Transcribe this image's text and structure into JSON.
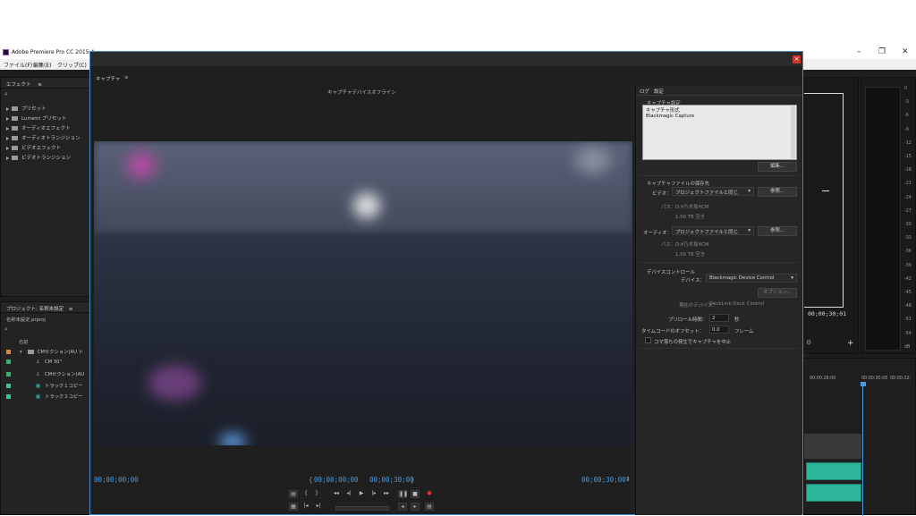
{
  "app": {
    "title": "Adobe Premiere Pro CC 2015.4 -",
    "window_controls": {
      "minimize": "–",
      "maximize": "❐",
      "close": "✕"
    }
  },
  "menu": [
    "ファイル(F)",
    "編集(E)",
    "クリップ(C)"
  ],
  "effects_panel": {
    "title": "エフェクト",
    "menu_glyph": "≡",
    "items": [
      "プリセット",
      "Lumetri プリセット",
      "オーディオエフェクト",
      "オーディオトランジション",
      "ビデオエフェクト",
      "ビデオトランジション"
    ]
  },
  "project_panel": {
    "title": "プロジェクト: 名称未設定",
    "menu_glyph": "≡",
    "more_glyph": "»",
    "file": "名称未設定.prproj",
    "column_name": "名前",
    "items": [
      {
        "label": "CMセクション(AU ト",
        "color": "#e08a2b",
        "kind": "folder"
      },
      {
        "label": "CM 30\"",
        "color": "#2fb56b",
        "kind": "sequence"
      },
      {
        "label": "CMセクション(AU",
        "color": "#2fb56b",
        "kind": "sequence"
      },
      {
        "label": "トラック１コピー",
        "color": "#2fc89a",
        "kind": "audio"
      },
      {
        "label": "トラック２コピー",
        "color": "#2fc89a",
        "kind": "audio"
      }
    ]
  },
  "capture": {
    "panel_title": "キャプチャ",
    "menu_glyph": "≡",
    "close": "×",
    "status": "キャプチャデバイスオフライン",
    "timecode_left": "00;00;00;00",
    "timecode_in": "00;00;00;00",
    "timecode_out": "00;00;30;00",
    "timecode_right": "00;00;30;00",
    "brace_open": "{",
    "brace_close": "}",
    "tabs": [
      "ログ",
      "設定"
    ],
    "settings": {
      "capture_settings_header": "キャプチャ設定",
      "capture_format_label": "キャプチャ形式",
      "capture_format_value": "Blackmagic Capture",
      "edit_button": "編集...",
      "locations_header": "キャプチャファイルの保存先",
      "video_label": "ビデオ：",
      "video_select": "プロジェクトファイルと同じ",
      "browse_button": "参照...",
      "path_label": "パス：",
      "video_path": "D:¥乃木坂¥CM",
      "video_free": "1.56 TB 空き",
      "audio_label": "オーディオ：",
      "audio_select": "プロジェクトファイルと同じ",
      "audio_path": "D:¥乃木坂¥CM",
      "audio_free": "1.56 TB 空き",
      "device_control_header": "デバイスコントロール",
      "device_label": "デバイス：",
      "device_value": "Blackmagic Device Control",
      "options_button": "オプション...",
      "current_device_label": "現在のデバイス：",
      "current_device_value": "DeckLink Deck Control",
      "preroll_label": "プリロール時間：",
      "preroll_value": "2",
      "preroll_unit": "秒",
      "offset_label": "タイムコードのオフセット：",
      "offset_value": "0.0",
      "offset_unit": "フレーム",
      "abort_label": "コマ落ちの発生でキャプチャを中止"
    }
  },
  "right": {
    "monitor_timecode": "00;00;30;01",
    "timeline_ticks": [
      "00;00;28;00",
      "00;00;30;00",
      "00;00;32;"
    ],
    "meter_scale": [
      "0",
      "-3",
      "-6",
      "-9",
      "-12",
      "-15",
      "-18",
      "-21",
      "-24",
      "-27",
      "-30",
      "-33",
      "-36",
      "-39",
      "-42",
      "-45",
      "-48",
      "-51",
      "-54",
      "dB"
    ],
    "plus": "+"
  },
  "colors": {
    "accent": "#4a9be0",
    "clip": "#2db59a",
    "close": "#c7372f"
  }
}
